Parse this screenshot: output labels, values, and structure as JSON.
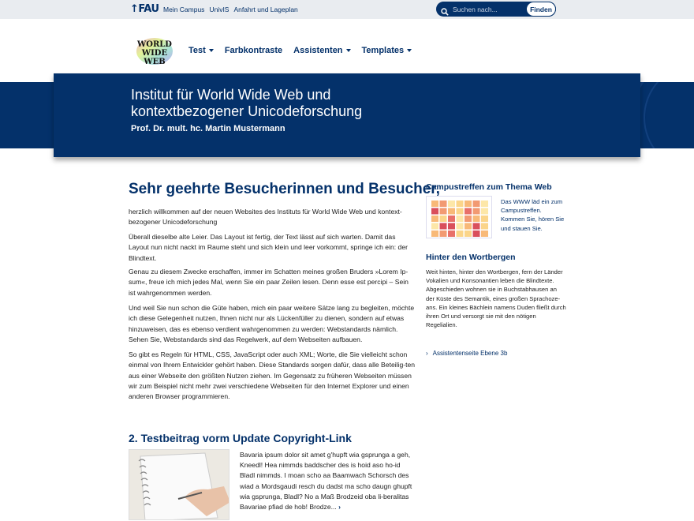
{
  "topbar": {
    "brand": "FAU",
    "links": [
      "Mein Campus",
      "UnivIS",
      "Anfahrt und Lageplan"
    ],
    "search_placeholder": "Suchen nach...",
    "search_button": "Finden"
  },
  "logo": {
    "line1": "WORLD",
    "line2": "WIDE",
    "line3": "WEB"
  },
  "nav": [
    {
      "label": "Test",
      "dropdown": true
    },
    {
      "label": "Farbkontraste",
      "dropdown": false
    },
    {
      "label": "Assistenten",
      "dropdown": true
    },
    {
      "label": "Templates",
      "dropdown": true
    }
  ],
  "hero": {
    "title": "Institut für World Wide Web und kontextbezogener Unicodeforschung",
    "subtitle": "Prof. Dr. mult. hc. Martin Mustermann"
  },
  "main": {
    "heading": "Sehr geehrte Besucherinnen und Besucher,",
    "paragraphs": [
      "herzlich willkommen auf der neuen Websites des Instituts für World Wide Web und kontext-bezogener Unicodeforschung",
      "Überall dieselbe alte Leier. Das Layout ist fertig, der Text lässt auf sich warten. Damit das Layout nun nicht nackt im Raume steht und sich klein und leer vorkommt, springe ich ein: der Blindtext.",
      "Genau zu diesem Zwecke erschaffen, immer im Schatten meines großen Bruders »Lorem Ip-sum«, freue ich mich jedes Mal, wenn Sie ein paar Zeilen lesen. Denn esse est percipi – Sein ist wahrgenommen werden.",
      "Und weil Sie nun schon die Güte haben, mich ein paar weitere Sätze lang zu begleiten, möchte ich diese Gelegenheit nutzen, Ihnen nicht nur als Lückenfüller zu dienen, sondern auf etwas hinzuweisen, das es ebenso verdient wahrgenommen zu werden: Webstandards nämlich. Sehen Sie, Webstandards sind das Regelwerk, auf dem Webseiten aufbauen.",
      "So gibt es Regeln für HTML, CSS, JavaScript oder auch XML; Worte, die Sie vielleicht schon einmal von Ihrem Entwickler gehört haben. Diese Standards sorgen dafür, dass alle Beteilig-ten aus einer Webseite den größten Nutzen ziehen. Im Gegensatz zu früheren Webseiten müssen wir zum Beispiel nicht mehr zwei verschiedene Webseiten für den Internet Explorer und einen anderen Browser programmieren."
    ],
    "post_title": "2. Testbeitrag vorm Update Copyright-Link",
    "post_teaser": "Bavaria ipsum dolor sit amet g'hupft wia gsprunga a geh, Kneedl! Hea nimmds baddscher des is hoid aso ho-id Bladl nimmds. I moan scho aa Baamwach Schorsch des wiad a Mordsgaudi resch du dadst ma scho daugn ghupft wia gsprunga, Bladl? No a Maß Brodzeid oba li-beralitas Bavariae pfiad de hob! Brodze...",
    "post_more": "›"
  },
  "sidebar": {
    "widget1_title": "Campustreffen zum Thema Web",
    "widget1_text": "Das WWW läd ein zum Campustreffen. Kommen Sie, hören Sie und stauen Sie.",
    "widget2_title": "Hinter den Wortbergen",
    "widget2_text": "Weit hinten, hinter den Wortbergen, fern der Länder Vokalien und Konsonantien leben die Blindtexte. Abgeschieden wohnen sie in Buchstabhausen an der Küste des Semantik, eines großen Sprachoze-ans. Ein kleines Bächlein namens Duden fließt durch ihren Ort und versorgt sie mit den nötigen Regelialien.",
    "link_arrow": "›",
    "link_label": "Assistentenseite Ebene 3b"
  },
  "colors": {
    "brand": "#04316a",
    "topbar_bg": "#e9ecf0"
  }
}
